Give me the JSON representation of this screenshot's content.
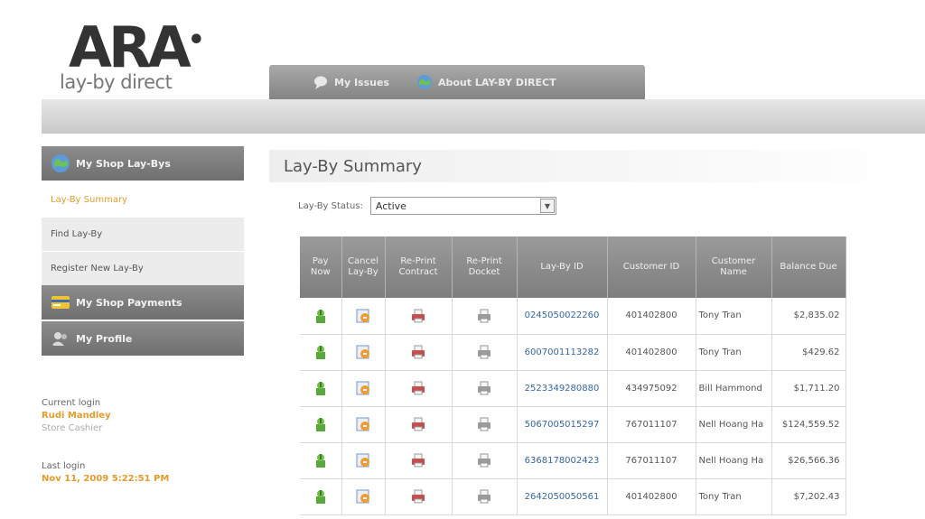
{
  "logo": {
    "mark": "ARA",
    "tagline": "lay-by direct"
  },
  "nav_tabs": [
    {
      "label": "My Issues",
      "icon": "chat-icon"
    },
    {
      "label": "About LAY-BY DIRECT",
      "icon": "globe-icon"
    }
  ],
  "sidebar": {
    "sections": [
      {
        "label": "My Shop Lay-Bys",
        "icon": "globe-icon"
      },
      {
        "label": "My Shop Payments",
        "icon": "card-icon"
      },
      {
        "label": "My Profile",
        "icon": "user-icon"
      }
    ],
    "items": [
      {
        "label": "Lay-By Summary",
        "active": true
      },
      {
        "label": "Find Lay-By",
        "active": false
      },
      {
        "label": "Register New Lay-By",
        "active": false
      }
    ]
  },
  "login": {
    "current_label": "Current login",
    "current_name": "Rudi Mandley",
    "current_role": "Store Cashier",
    "last_label": "Last login",
    "last_time": "Nov 11, 2009 5:22:51 PM"
  },
  "page_title": "Lay-By Summary",
  "status_filter": {
    "label": "Lay-By Status:",
    "value": "Active"
  },
  "table": {
    "headers": [
      "Pay Now",
      "Cancel Lay-By",
      "Re-Print Contract",
      "Re-Print Docket",
      "Lay-By ID",
      "Customer ID",
      "Customer Name",
      "Balance Due"
    ],
    "rows": [
      {
        "layby_id": "0245050022260",
        "customer_id": "401402800",
        "customer_name": "Tony Tran",
        "balance": "$2,835.02"
      },
      {
        "layby_id": "6007001113282",
        "customer_id": "401402800",
        "customer_name": "Tony Tran",
        "balance": "$429.62"
      },
      {
        "layby_id": "2523349280880",
        "customer_id": "434975092",
        "customer_name": "Bill Hammond",
        "balance": "$1,711.20"
      },
      {
        "layby_id": "5067005015297",
        "customer_id": "767011107",
        "customer_name": "Nell Hoang Ha",
        "balance": "$124,559.52"
      },
      {
        "layby_id": "6368178002423",
        "customer_id": "767011107",
        "customer_name": "Nell Hoang Ha",
        "balance": "$26,566.36"
      },
      {
        "layby_id": "2642050050561",
        "customer_id": "401402800",
        "customer_name": "Tony Tran",
        "balance": "$7,202.43"
      }
    ]
  },
  "colors": {
    "accent": "#e69b2a",
    "link": "#3566a6",
    "header_grey": "#848484"
  }
}
